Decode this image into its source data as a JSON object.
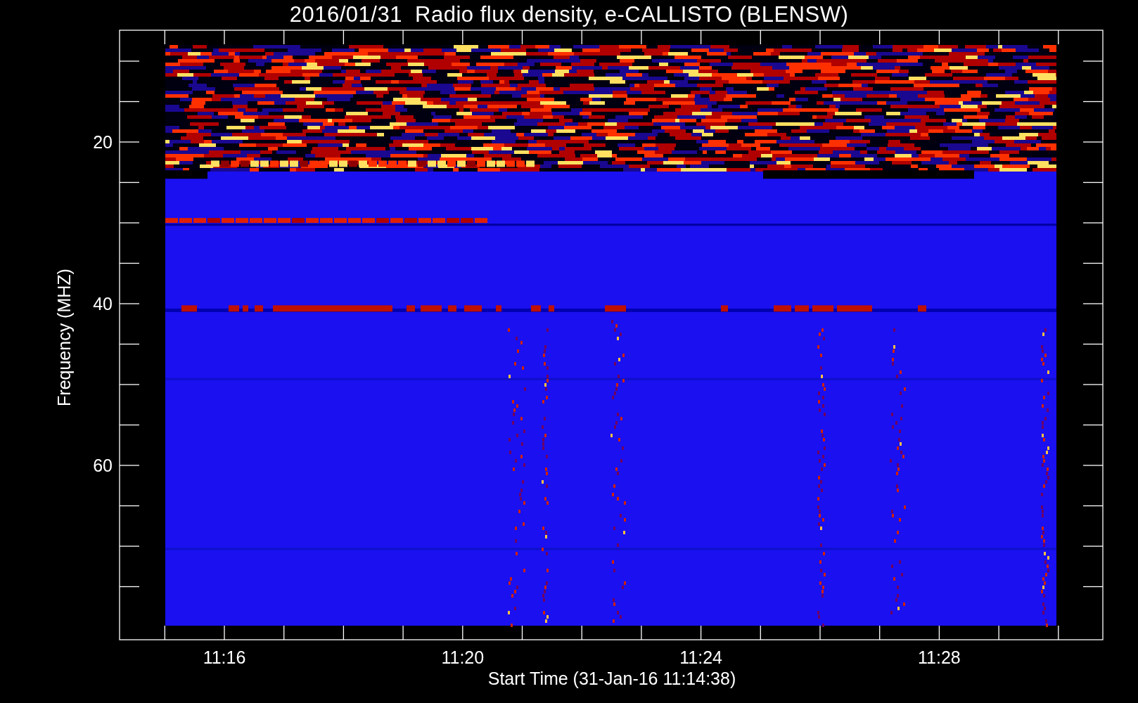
{
  "title": "2016/01/31  Radio flux density, e-CALLISTO (BLENSW)",
  "plot": {
    "ylabel": "Frequency (MHZ)",
    "xlabel": "Start Time (31-Jan-16 11:14:38)",
    "yticks": [
      {
        "label": "20"
      },
      {
        "label": "40"
      },
      {
        "label": "60"
      }
    ],
    "xticks": [
      {
        "label": "11:16"
      },
      {
        "label": "11:20"
      },
      {
        "label": "11:24"
      },
      {
        "label": "11:28"
      }
    ]
  }
}
